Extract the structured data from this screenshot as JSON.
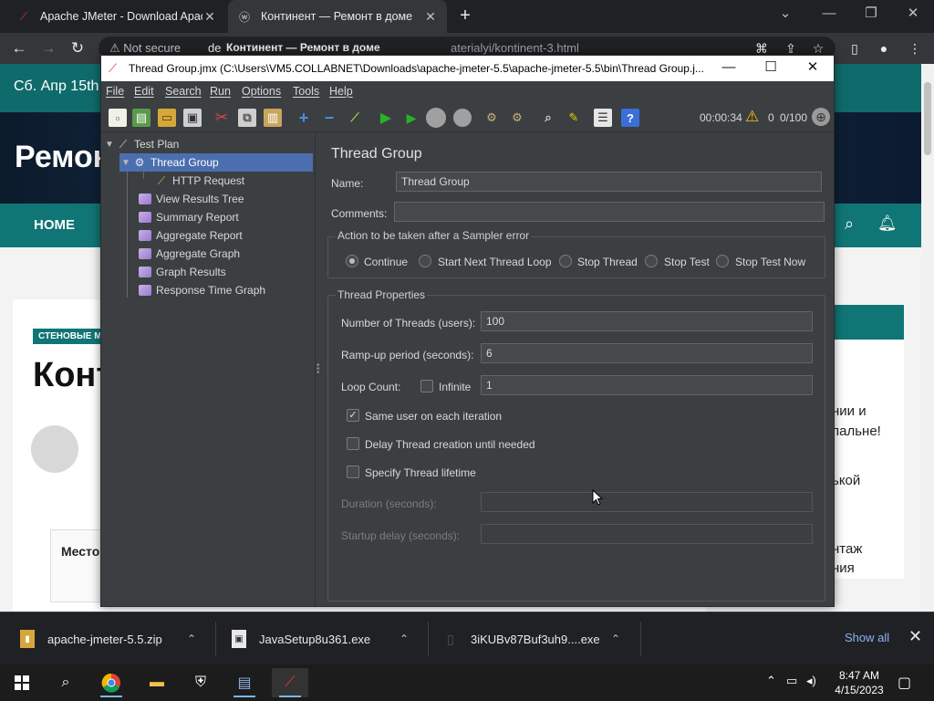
{
  "browser": {
    "tabs": [
      {
        "title": "Apache JMeter - Download Apac"
      },
      {
        "title": "Континент — Ремонт в доме"
      }
    ],
    "address": {
      "not_secure": "Not secure",
      "url_start": "de",
      "url_tail": "aterialyi/kontinent-3.html",
      "hover_title": "Континент — Ремонт в доме"
    }
  },
  "website": {
    "date": "Сб. Апр 15th",
    "logo": "Ремон",
    "nav_home": "HOME",
    "tag": "СТЕНОВЫЕ М",
    "title": "Конт",
    "box_title": "Место",
    "side": [
      "нии и",
      "пальне!",
      "ькой",
      "нтаж",
      "ния"
    ]
  },
  "jmeter": {
    "window_title": "Thread Group.jmx (C:\\Users\\VM5.COLLABNET\\Downloads\\apache-jmeter-5.5\\apache-jmeter-5.5\\bin\\Thread Group.j...",
    "menu": [
      "File",
      "Edit",
      "Search",
      "Run",
      "Options",
      "Tools",
      "Help"
    ],
    "status": {
      "elapsed": "00:00:34",
      "errors": "0",
      "threads": "0/100"
    },
    "tree": [
      {
        "label": "Test Plan"
      },
      {
        "label": "Thread Group"
      },
      {
        "label": "HTTP Request"
      },
      {
        "label": "View Results Tree"
      },
      {
        "label": "Summary Report"
      },
      {
        "label": "Aggregate Report"
      },
      {
        "label": "Aggregate Graph"
      },
      {
        "label": "Graph Results"
      },
      {
        "label": "Response Time Graph"
      }
    ],
    "panel": {
      "title": "Thread Group",
      "name_label": "Name:",
      "name_value": "Thread Group",
      "comments_label": "Comments:",
      "comments_value": "",
      "action_title": "Action to be taken after a Sampler error",
      "actions": [
        "Continue",
        "Start Next Thread Loop",
        "Stop Thread",
        "Stop Test",
        "Stop Test Now"
      ],
      "selected_action": "Continue",
      "props_title": "Thread Properties",
      "threads_label": "Number of Threads (users):",
      "threads_value": "100",
      "rampup_label": "Ramp-up period (seconds):",
      "rampup_value": "6",
      "loop_label": "Loop Count:",
      "infinite_label": "Infinite",
      "loop_value": "1",
      "same_user_label": "Same user on each iteration",
      "delay_label": "Delay Thread creation until needed",
      "lifetime_label": "Specify Thread lifetime",
      "duration_label": "Duration (seconds):",
      "startup_label": "Startup delay (seconds):"
    }
  },
  "downloads": {
    "items": [
      {
        "name": "apache-jmeter-5.5.zip"
      },
      {
        "name": "JavaSetup8u361.exe"
      },
      {
        "name": "3iKUBv87Buf3uh9....exe"
      }
    ],
    "show_all": "Show all"
  },
  "taskbar": {
    "time": "8:47 AM",
    "date": "4/15/2023"
  },
  "colors": {
    "jmeter_bg": "#3c3f41",
    "selection": "#4b6eaf",
    "site_teal": "#107575",
    "chrome_dark": "#202124"
  }
}
